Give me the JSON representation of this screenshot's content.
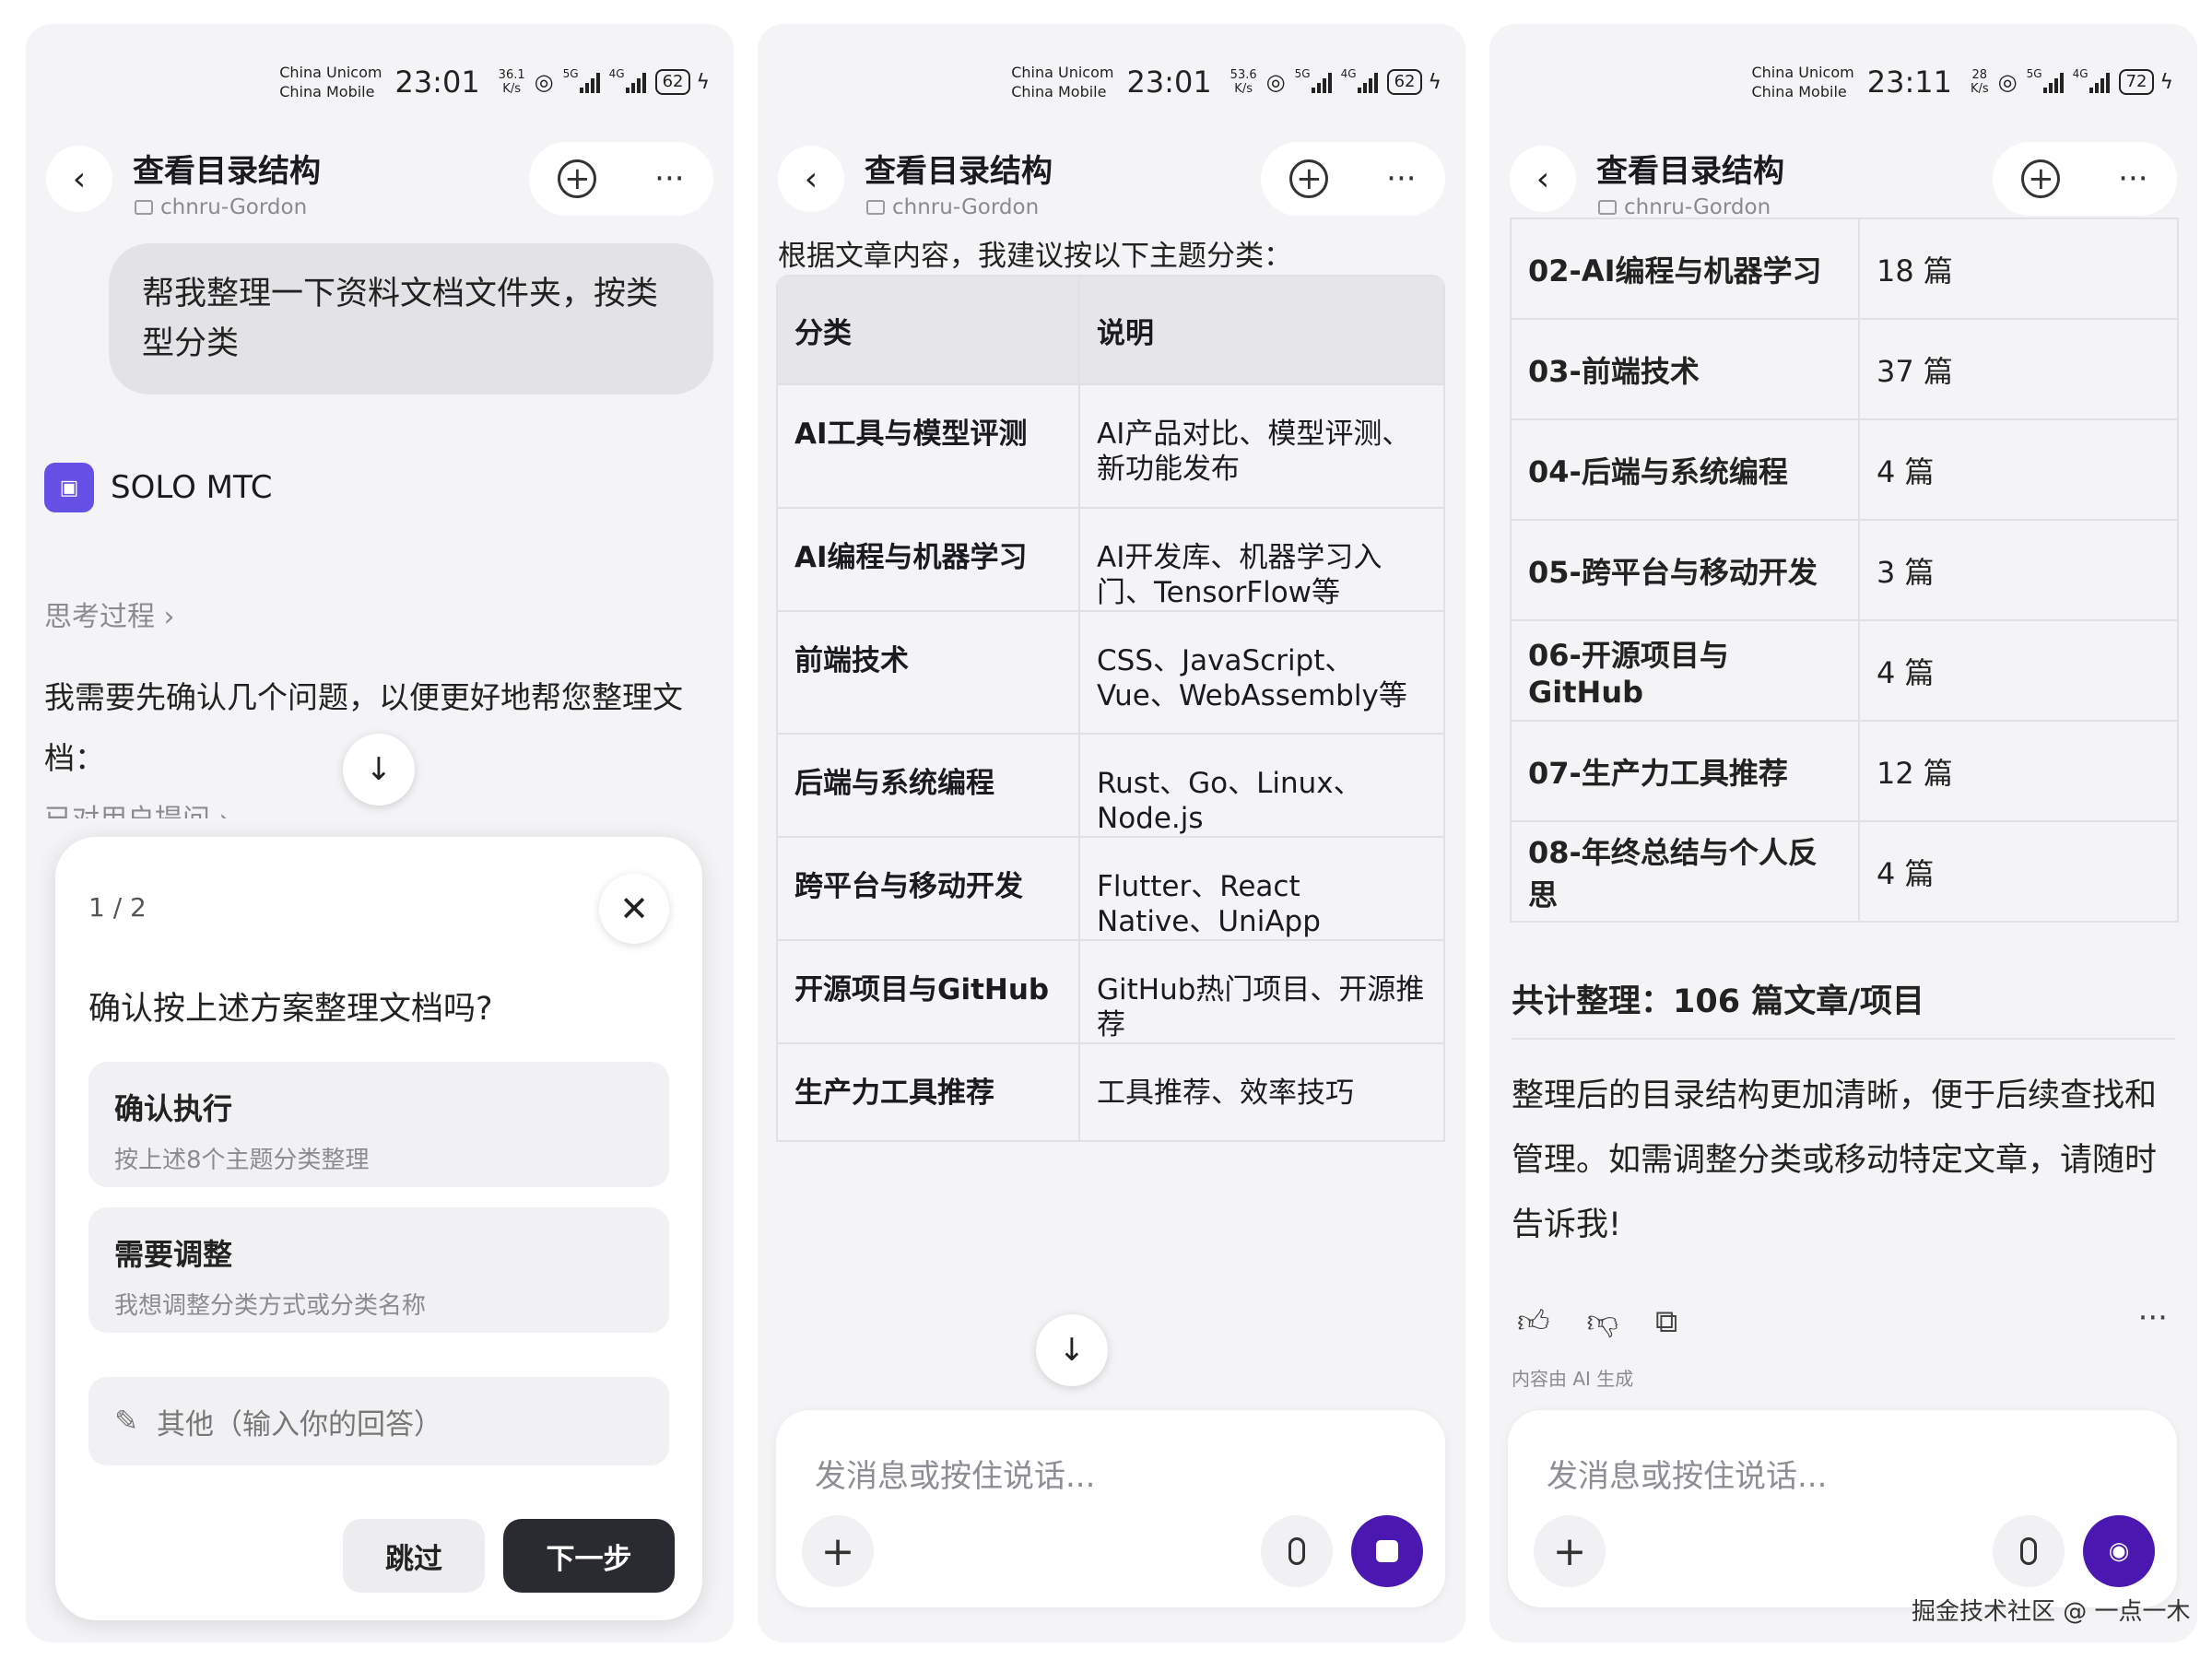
{
  "status_bars": [
    {
      "carrier_top": "China Unicom",
      "carrier_bottom": "China Mobile",
      "time": "23:01",
      "speed_value": "36.1",
      "speed_unit": "K/s",
      "net1": "5G",
      "net2": "4G",
      "battery": "62"
    },
    {
      "carrier_top": "China Unicom",
      "carrier_bottom": "China Mobile",
      "time": "23:01",
      "speed_value": "53.6",
      "speed_unit": "K/s",
      "net1": "5G",
      "net2": "4G",
      "battery": "62"
    },
    {
      "carrier_top": "China Unicom",
      "carrier_bottom": "China Mobile",
      "time": "23:11",
      "speed_value": "28",
      "speed_unit": "K/s",
      "net1": "5G",
      "net2": "4G",
      "battery": "72"
    }
  ],
  "header": {
    "title": "查看目录结构",
    "subtitle": "chnru-Gordon"
  },
  "panel1": {
    "user_message": "帮我整理一下资料文档文件夹，按类型分类",
    "bot_name": "SOLO MTC",
    "thinking_label": "思考过程 ›",
    "answer": "我需要先确认几个问题，以便更好地帮您整理文档：",
    "asked_label": "已对用户提问 ›",
    "dialog": {
      "page": "1 / 2",
      "question": "确认按上述方案整理文档吗?",
      "options": [
        {
          "title": "确认执行",
          "desc": "按上述8个主题分类整理"
        },
        {
          "title": "需要调整",
          "desc": "我想调整分类方式或分类名称"
        }
      ],
      "other_placeholder": "其他（输入你的回答）",
      "skip_label": "跳过",
      "next_label": "下一步"
    }
  },
  "panel2": {
    "intro": "根据文章内容，我建议按以下主题分类：",
    "columns": [
      "分类",
      "说明"
    ],
    "rows": [
      {
        "category": "AI工具与模型评测",
        "desc": "AI产品对比、模型评测、新功能发布",
        "h": 134
      },
      {
        "category": "AI编程与机器学习",
        "desc": "AI开发库、机器学习入门、TensorFlow等",
        "h": 106
      },
      {
        "category": "前端技术",
        "desc": "CSS、JavaScript、Vue、WebAssembly等",
        "h": 133
      },
      {
        "category": "后端与系统编程",
        "desc": "Rust、Go、Linux、Node.js",
        "h": 106
      },
      {
        "category": "跨平台与移动开发",
        "desc": "Flutter、React Native、UniApp",
        "h": 106
      },
      {
        "category": "开源项目与GitHub",
        "desc": "GitHub热门项目、开源推荐",
        "h": 106
      },
      {
        "category": "生产力工具推荐",
        "desc": "工具推荐、效率技巧",
        "h": 106
      }
    ],
    "input_placeholder": "发消息或按住说话..."
  },
  "panel3": {
    "rows": [
      {
        "name": "02-AI编程与机器学习",
        "count": "18 篇"
      },
      {
        "name": "03-前端技术",
        "count": "37 篇"
      },
      {
        "name": "04-后端与系统编程",
        "count": "4 篇"
      },
      {
        "name": "05-跨平台与移动开发",
        "count": "3 篇"
      },
      {
        "name": "06-开源项目与GitHub",
        "count": "4 篇"
      },
      {
        "name": "07-生产力工具推荐",
        "count": "12 篇"
      },
      {
        "name": "08-年终总结与个人反思",
        "count": "4 篇"
      }
    ],
    "total": "共计整理：106 篇文章/项目",
    "summary": "整理后的目录结构更加清晰，便于后续查找和管理。如需调整分类或移动特定文章，请随时告诉我!",
    "ai_generated": "内容由 AI 生成",
    "input_placeholder": "发消息或按住说话..."
  },
  "colors": {
    "accent_purple": "#4a18b0",
    "logo_purple": "#6550e6",
    "dark_button": "#2a2b30"
  },
  "icons": [
    "back-arrow-icon",
    "new-chat-icon",
    "more-icon",
    "scroll-down-icon",
    "close-icon",
    "pencil-icon",
    "plus-icon",
    "mic-icon",
    "stop-icon",
    "voice-wave-icon",
    "thumbs-up-icon",
    "thumbs-down-icon",
    "copy-icon"
  ],
  "watermark": "掘金技术社区 @ 一点一木"
}
